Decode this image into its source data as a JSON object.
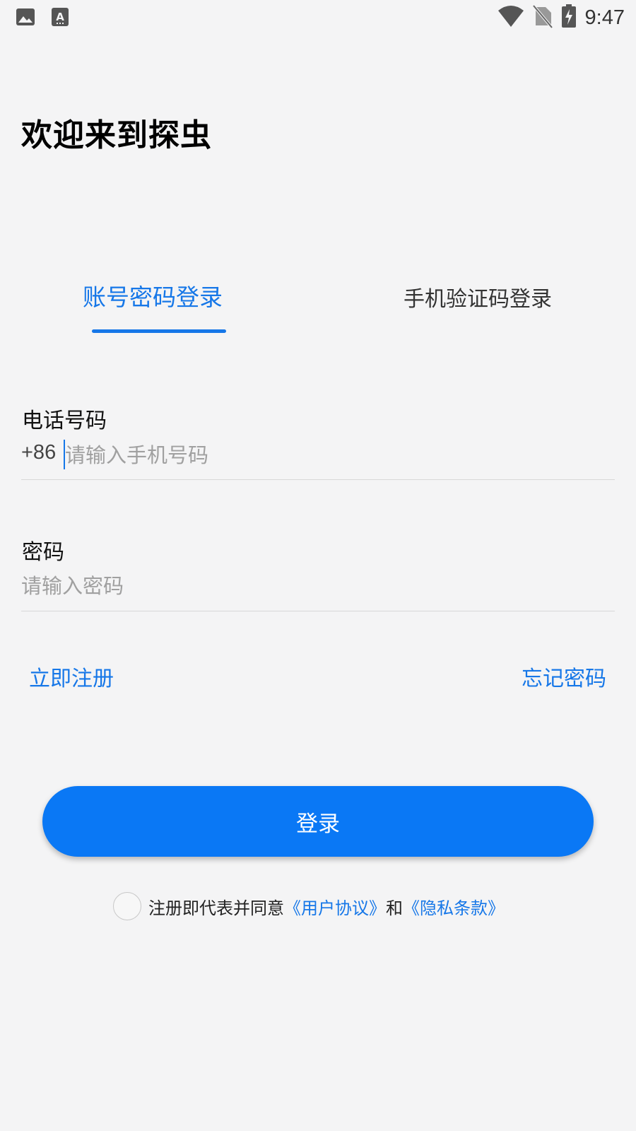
{
  "status_bar": {
    "time": "9:47",
    "icons": [
      "image-icon",
      "text-a-icon",
      "wifi-icon",
      "no-sim-icon",
      "battery-charging-icon"
    ]
  },
  "welcome_title": "欢迎来到探虫",
  "tabs": [
    {
      "label": "账号密码登录",
      "active": true
    },
    {
      "label": "手机验证码登录",
      "active": false
    }
  ],
  "phone_field": {
    "label": "电话号码",
    "prefix": "+86",
    "placeholder": "请输入手机号码",
    "value": ""
  },
  "password_field": {
    "label": "密码",
    "placeholder": "请输入密码",
    "value": ""
  },
  "links": {
    "register": "立即注册",
    "forgot": "忘记密码"
  },
  "login_button": "登录",
  "agreement": {
    "checked": false,
    "text": "注册即代表并同意",
    "user_agreement": "《用户协议》",
    "and": "和",
    "privacy": "《隐私条款》"
  },
  "colors": {
    "accent": "#1677e8",
    "button": "#0a78f5",
    "background": "#f4f4f5"
  }
}
